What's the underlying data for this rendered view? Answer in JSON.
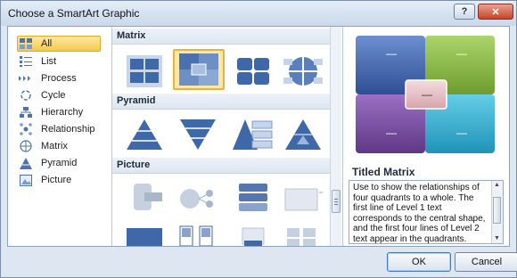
{
  "window": {
    "title": "Choose a SmartArt Graphic",
    "help_label": "?",
    "close_label": "✕"
  },
  "categories": [
    {
      "label": "All",
      "icon": "all-icon",
      "selected": true
    },
    {
      "label": "List",
      "icon": "list-icon"
    },
    {
      "label": "Process",
      "icon": "process-icon"
    },
    {
      "label": "Cycle",
      "icon": "cycle-icon"
    },
    {
      "label": "Hierarchy",
      "icon": "hierarchy-icon"
    },
    {
      "label": "Relationship",
      "icon": "relationship-icon"
    },
    {
      "label": "Matrix",
      "icon": "matrix-icon"
    },
    {
      "label": "Pyramid",
      "icon": "pyramid-icon"
    },
    {
      "label": "Picture",
      "icon": "picture-icon"
    }
  ],
  "gallery": {
    "sections": [
      "Matrix",
      "Pyramid",
      "Picture"
    ],
    "selected": "Titled Matrix"
  },
  "preview": {
    "title": "Titled Matrix",
    "description": "Use to show the relationships of four quadrants to a whole. The first line of Level 1 text corresponds to the central shape, and the first four lines of Level 2 text appear in the quadrants. Unused text does not appear, but remains available if you switch layouts.",
    "dash": "—",
    "colors": {
      "top_left": "#3d5ea8",
      "top_right": "#8bbb3f",
      "bottom_left": "#7c4fa3",
      "bottom_right": "#33b1d6",
      "center": "#e7c3c8"
    }
  },
  "buttons": {
    "ok": "OK",
    "cancel": "Cancel"
  }
}
